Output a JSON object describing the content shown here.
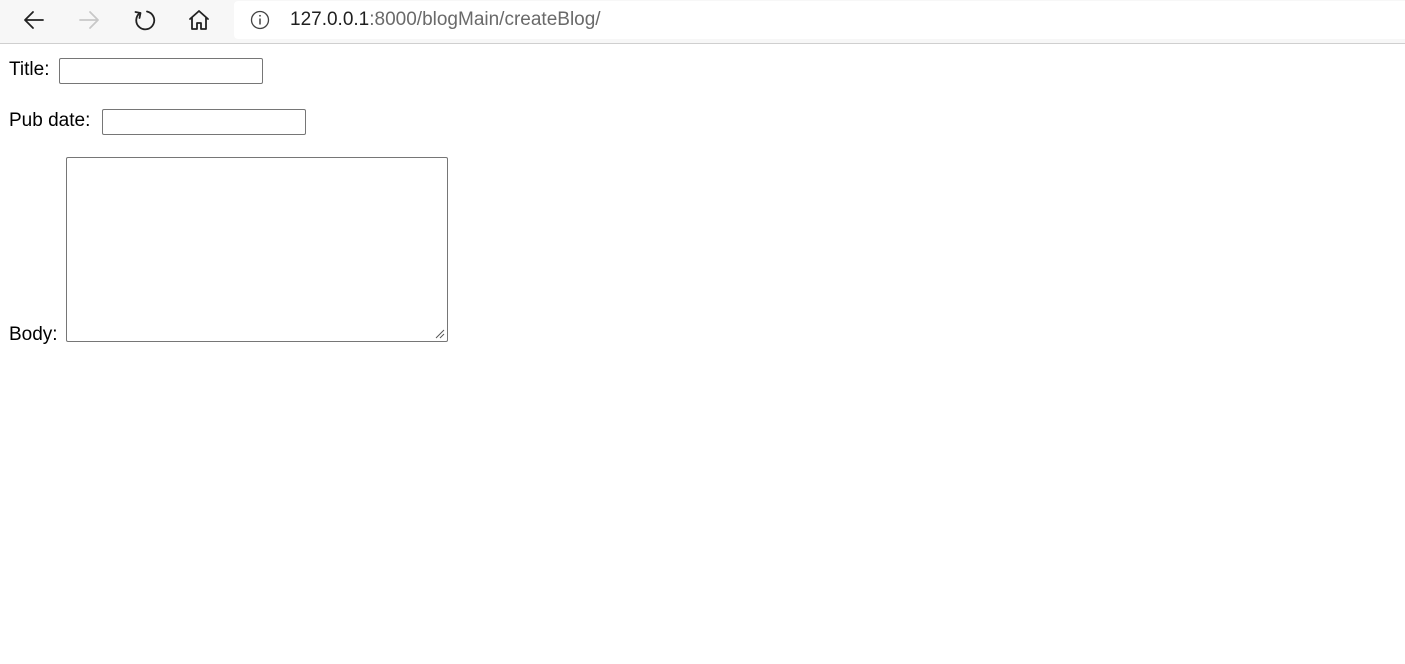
{
  "browser": {
    "url_host": "127.0.0.1",
    "url_rest": ":8000/blogMain/createBlog/",
    "icons": {
      "back": "back-arrow-icon",
      "forward": "forward-arrow-icon",
      "reload": "reload-icon",
      "home": "home-icon",
      "info": "info-icon"
    }
  },
  "form": {
    "title_label": "Title:",
    "title_value": "",
    "pub_date_label": "Pub date:",
    "pub_date_value": "",
    "body_label": "Body:",
    "body_value": ""
  }
}
